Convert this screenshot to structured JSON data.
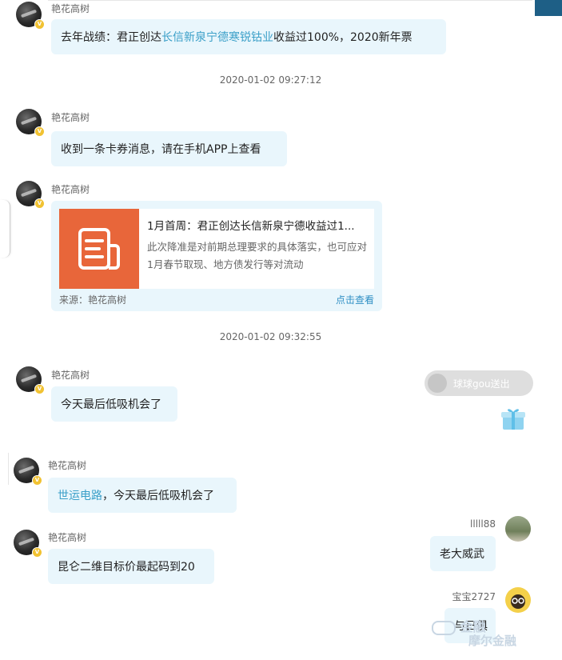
{
  "messages": [
    {
      "sender": "艳花高树",
      "text_before": "去年战绩：君正创达",
      "link": "长信新泉宁德寒锐钴业",
      "text_after": "收益过100%，2020新年票"
    },
    {
      "sender": "艳花高树",
      "text": "收到一条卡券消息，请在手机APP上查看"
    },
    {
      "sender": "艳花高树"
    },
    {
      "sender": "艳花高树",
      "text": "今天最后低吸机会了"
    },
    {
      "sender": "艳花高树",
      "link": "世运电路",
      "text_after": "，今天最后低吸机会了"
    },
    {
      "sender": "艳花高树",
      "text": "昆仑二维目标价最起码到20"
    },
    {
      "sender": "lllll88",
      "text": "老大威武"
    },
    {
      "sender": "宝宝2727",
      "text": "与日俱"
    }
  ],
  "timestamps": [
    "2020-01-02 09:27:12",
    "2020-01-02 09:32:55"
  ],
  "card": {
    "title": "1月首周：君正创达长信新泉宁德收益过1...",
    "desc": "此次降准是对前期总理要求的具体落实，也可应对1月春节取现、地方债发行等对流动",
    "source": "来源：艳花高树",
    "view": "点击查看"
  },
  "gift": {
    "text": "球球gou送出"
  },
  "watermark": {
    "line1": "金融",
    "line2": "摩尔金融"
  },
  "colors": {
    "bubble": "#e9f6fc",
    "link": "#3a9fc8",
    "card_thumb": "#e8663a",
    "badge": "#f1c232"
  },
  "icons": [
    "verified-badge-icon",
    "document-icon",
    "gift-box-icon"
  ]
}
